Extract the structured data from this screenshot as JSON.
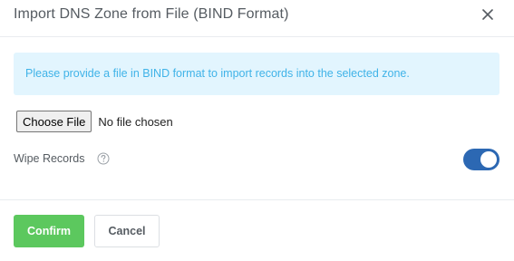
{
  "dialog": {
    "title": "Import DNS Zone from File (BIND Format)",
    "close_icon": "close-icon"
  },
  "alert": {
    "message": "Please provide a file in BIND format to import records into the selected zone.",
    "color": "#40b3e8",
    "background": "#e2f5fe"
  },
  "file_input": {
    "button_label": "Choose File",
    "status": "No file chosen"
  },
  "wipe_records": {
    "label": "Wipe Records",
    "help_icon": "question-circle-icon",
    "enabled": true,
    "toggle_color": "#2c68b3"
  },
  "footer": {
    "confirm_label": "Confirm",
    "cancel_label": "Cancel",
    "confirm_color": "#5cc85e"
  }
}
